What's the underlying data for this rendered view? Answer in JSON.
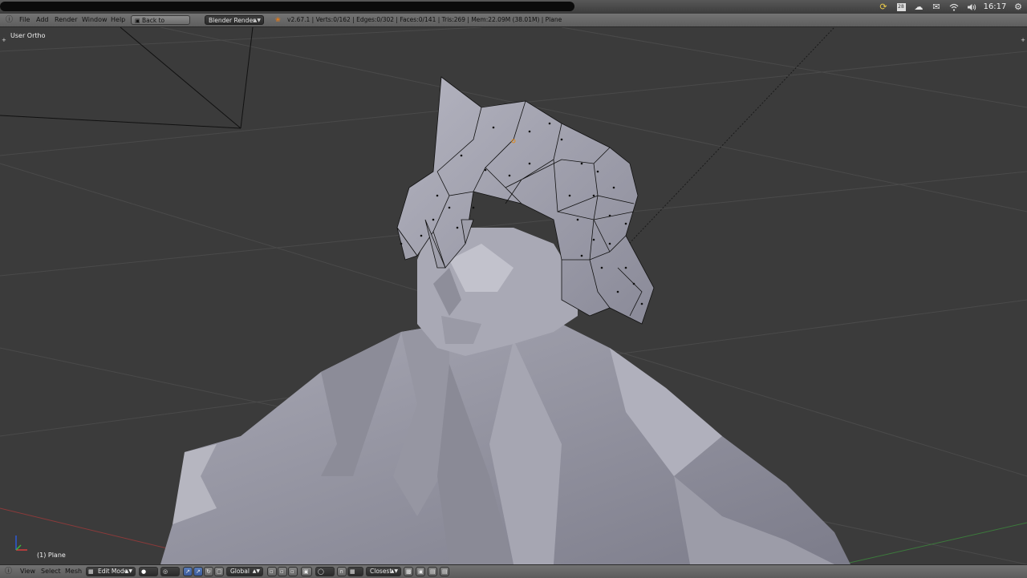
{
  "menu": {
    "items": [
      "File",
      "Add",
      "Render",
      "Window",
      "Help"
    ],
    "back_button": "Back to Previous",
    "render_engine": "Blender Render",
    "stats": "v2.67.1 | Verts:0/162 | Edges:0/302 | Faces:0/141 | Tris:269 | Mem:22.09M (38.01M) | Plane"
  },
  "system_tray": {
    "time": "16:17",
    "calendar_day": "28",
    "icons": [
      "sync-icon",
      "calendar-icon",
      "cloud-icon",
      "mail-icon",
      "wifi-icon",
      "volume-icon",
      "gear-icon"
    ]
  },
  "viewport": {
    "view_name": "User Ortho",
    "object_label": "(1) Plane"
  },
  "footer": {
    "menus": [
      "View",
      "Select",
      "Mesh"
    ],
    "mode": "Edit Mode",
    "orientation": "Global",
    "snap_target": "Closest"
  },
  "colors": {
    "viewport_bg": "#3b3b3b",
    "mesh_fill": "#9a9aa6",
    "header_bg": "#6a6a6a",
    "active_blue": "#4a6aaa"
  }
}
